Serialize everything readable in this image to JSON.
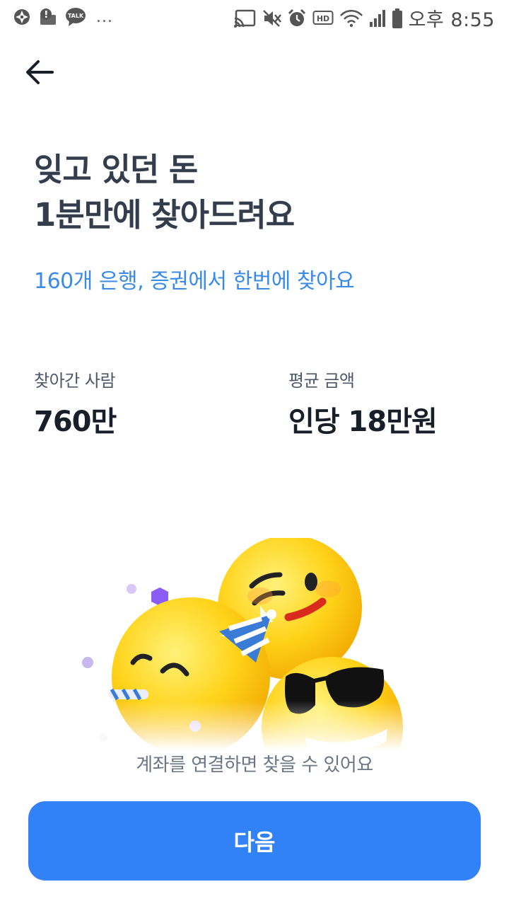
{
  "status_bar": {
    "left_icons": [
      "aperture-icon",
      "alert-photo-icon",
      "kakaotalk-icon"
    ],
    "kakao_label": "TALK",
    "more": "...",
    "right_icons": [
      "cast-icon",
      "mute-icon",
      "alarm-icon",
      "hd-icon",
      "wifi-icon",
      "signal-icon",
      "battery-icon"
    ],
    "hd_label": "HD",
    "time": "오후 8:55"
  },
  "header": {
    "back_icon": "arrow-left-icon"
  },
  "main": {
    "headline_line1": "잊고 있던 돈",
    "headline_line2": "1분만에 찾아드려요",
    "subtext": "160개 은행, 증권에서 한번에 찾아요",
    "stats": [
      {
        "label": "찾아간 사람",
        "value": "760만"
      },
      {
        "label": "평균 금액",
        "value": "인당 18만원"
      }
    ],
    "illustration": "emoji-faces-party-illustration",
    "caption": "계좌를 연결하면 찾을 수 있어요"
  },
  "footer": {
    "next_label": "다음"
  },
  "colors": {
    "accent": "#3182f6",
    "subtext": "#3a8ae8",
    "title": "#333d4b"
  }
}
